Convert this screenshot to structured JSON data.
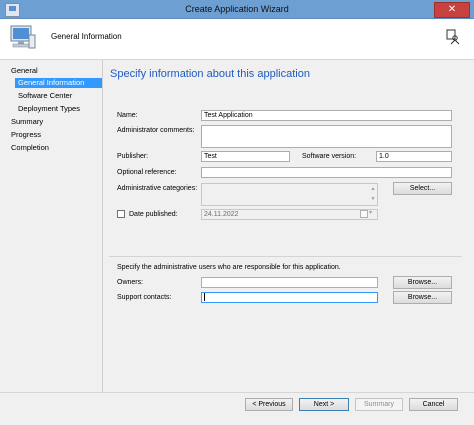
{
  "window": {
    "title": "Create Application Wizard",
    "close_glyph": "✕"
  },
  "header": {
    "page_title": "General Information"
  },
  "sidebar": {
    "items": [
      {
        "label": "General"
      },
      {
        "label": "General Information"
      },
      {
        "label": "Software Center"
      },
      {
        "label": "Deployment Types"
      },
      {
        "label": "Summary"
      },
      {
        "label": "Progress"
      },
      {
        "label": "Completion"
      }
    ]
  },
  "form": {
    "heading": "Specify information about this application",
    "name_label": "Name:",
    "name_value": "Test Application",
    "admin_comments_label": "Administrator comments:",
    "admin_comments_value": "",
    "publisher_label": "Publisher:",
    "publisher_value": "Test",
    "software_version_label": "Software version:",
    "software_version_value": "1.0",
    "optional_reference_label": "Optional reference:",
    "optional_reference_value": "",
    "admin_categories_label": "Administrative categories:",
    "admin_categories_value": "",
    "select_button": "Select...",
    "date_published_label": "Date published:",
    "date_published_value": "24.11.2022",
    "date_published_checked": false,
    "admin_users_text": "Specify the administrative users who are responsible for this application.",
    "owners_label": "Owners:",
    "owners_value": "",
    "support_contacts_label": "Support contacts:",
    "support_contacts_value": "",
    "browse_button": "Browse..."
  },
  "footer": {
    "previous": "< Previous",
    "next": "Next >",
    "summary": "Summary",
    "cancel": "Cancel"
  },
  "icons": {
    "header_icon": "computer-icon",
    "help_icon": "person-help-icon",
    "calendar_icon": "calendar-icon"
  },
  "colors": {
    "accent": "#3399ff",
    "heading": "#1f5bbf",
    "titlebar": "#6e9fd3",
    "close": "#c7423c"
  }
}
